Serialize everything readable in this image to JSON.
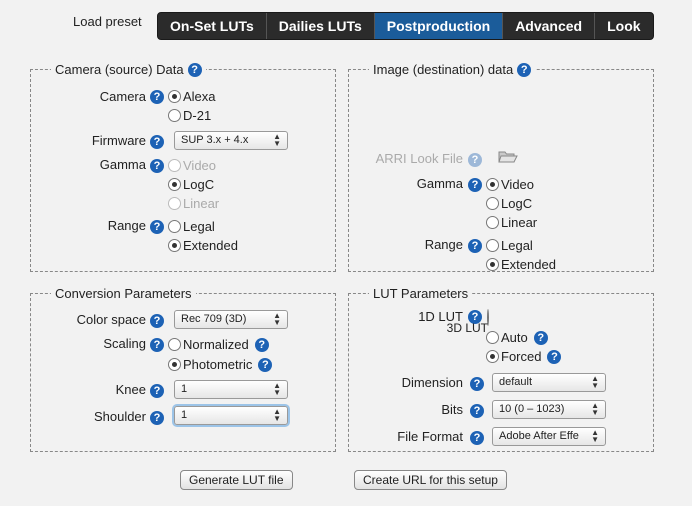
{
  "header": {
    "preset_label": "Load preset",
    "tabs": [
      {
        "label": "On-Set LUTs"
      },
      {
        "label": "Dailies LUTs"
      },
      {
        "label": "Postproduction"
      },
      {
        "label": "Advanced"
      },
      {
        "label": "Look"
      }
    ],
    "active_tab": "Postproduction"
  },
  "help_glyph": "?",
  "camera_box": {
    "legend": "Camera (source) Data",
    "camera": {
      "label": "Camera",
      "options": [
        "Alexa",
        "D-21"
      ],
      "selected": "Alexa"
    },
    "firmware": {
      "label": "Firmware",
      "value": "SUP 3.x + 4.x"
    },
    "gamma": {
      "label": "Gamma",
      "options": [
        "Video",
        "LogC",
        "Linear"
      ],
      "selected": "LogC"
    },
    "range": {
      "label": "Range",
      "options": [
        "Legal",
        "Extended"
      ],
      "selected": "Extended"
    }
  },
  "image_box": {
    "legend": "Image (destination) data",
    "look_file": {
      "label": "ARRI Look File"
    },
    "gamma": {
      "label": "Gamma",
      "options": [
        "Video",
        "LogC",
        "Linear"
      ],
      "selected": "Video"
    },
    "range": {
      "label": "Range",
      "options": [
        "Legal",
        "Extended"
      ],
      "selected": "Extended"
    }
  },
  "conversion_box": {
    "legend": "Conversion Parameters",
    "color_space": {
      "label": "Color space",
      "value": "Rec 709 (3D)"
    },
    "scaling": {
      "label": "Scaling",
      "options": [
        "Normalized",
        "Photometric"
      ],
      "selected": "Photometric"
    },
    "knee": {
      "label": "Knee",
      "value": "1"
    },
    "shoulder": {
      "label": "Shoulder",
      "value": "1"
    }
  },
  "lut_box": {
    "legend": "LUT Parameters",
    "lut1d": {
      "label": "1D LUT"
    },
    "lut3d": {
      "label": "3D LUT",
      "options": [
        "Auto",
        "Forced"
      ],
      "selected": "Forced"
    },
    "dimension": {
      "label": "Dimension",
      "value": "default"
    },
    "bits": {
      "label": "Bits",
      "value": "10 (0 – 1023)"
    },
    "file_format": {
      "label": "File Format",
      "value": "Adobe After Effe"
    }
  },
  "buttons": {
    "generate": "Generate LUT file",
    "create_url": "Create URL for this setup"
  },
  "colors": {
    "active_tab": "#1b5c9a",
    "tab_bar": "#2b2b2b",
    "help": "#1d62b5"
  }
}
